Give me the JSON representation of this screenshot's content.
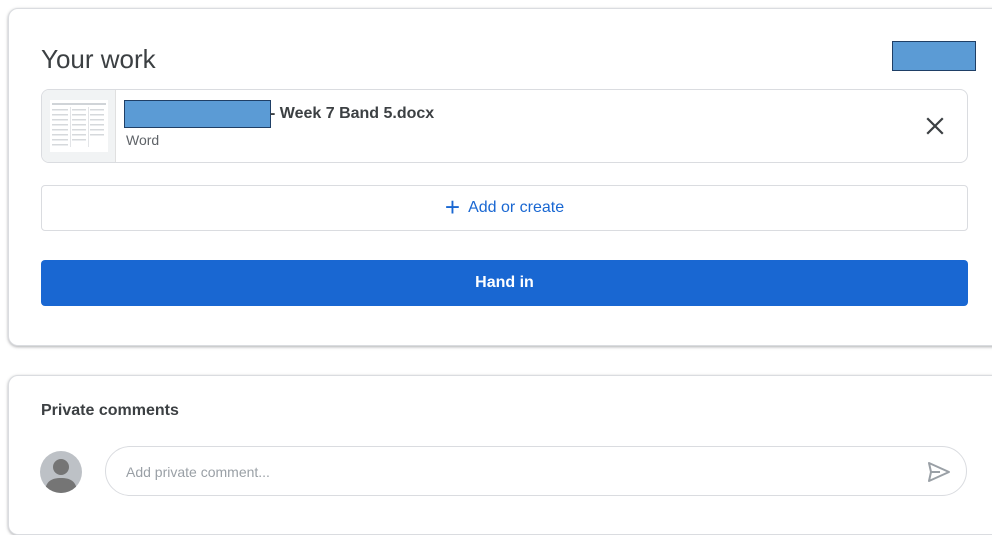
{
  "your_work": {
    "title": "Your work",
    "attachment": {
      "file_name": "- Week 7 Band 5.docx",
      "file_type": "Word",
      "remove_icon": "close-icon"
    },
    "add_label": "Add or create",
    "add_icon": "plus-icon",
    "hand_in_label": "Hand in"
  },
  "private_comments": {
    "title": "Private comments",
    "avatar_icon": "person-icon",
    "input_placeholder": "Add private comment...",
    "input_value": "",
    "send_icon": "send-icon"
  },
  "colors": {
    "accent": "#1967d2",
    "redaction": "#5b9bd5",
    "border": "#dadce0",
    "text": "#3c4043"
  }
}
